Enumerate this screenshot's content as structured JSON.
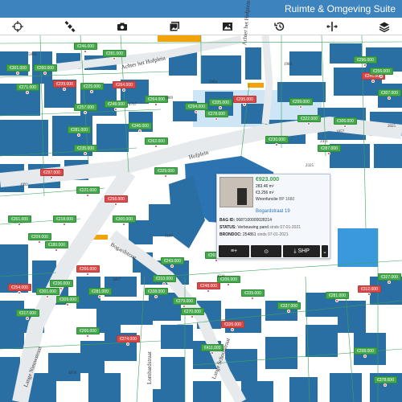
{
  "app": {
    "title": "Ruimte & Omgeving Suite"
  },
  "toolbar": {
    "items": [
      {
        "name": "crosshair-icon"
      },
      {
        "name": "satellite-icon"
      },
      {
        "name": "camera-icon"
      },
      {
        "name": "image-stack-icon"
      },
      {
        "name": "picture-icon"
      },
      {
        "name": "history-icon"
      },
      {
        "name": "split-icon"
      },
      {
        "name": "layers-icon"
      }
    ]
  },
  "map": {
    "colors": {
      "building": "#2a6fa3",
      "lot_blue": "#2c73b2",
      "light_blue": "#3a99db",
      "parcel_line": "#3aa35a",
      "road": "#e7eaed",
      "price": "#46a84d",
      "price_red": "#d84a48",
      "highlight": "#f0a30a"
    },
    "streets": [
      {
        "label": "Achter het Hofplein"
      },
      {
        "label": "Achter het Hofplein"
      },
      {
        "label": "Hofplein"
      },
      {
        "label": "Bogardstraat"
      },
      {
        "label": "Lange Nieuwstraat"
      },
      {
        "label": "Lombardstraat"
      },
      {
        "label": "Lange Schoolstraat"
      },
      {
        "label": "Bogardstraat 19"
      }
    ],
    "parcels": [
      "5064",
      "1984",
      "4767",
      "1869",
      "5094",
      "2325",
      "1992",
      "3867",
      "4511",
      "5107",
      "4878",
      "2025",
      "2411",
      "1857"
    ],
    "price_labels": [
      "€246.000",
      "€301.000",
      "€260.000",
      "€281.000",
      "€239.000",
      "€271.000",
      "€225.000",
      "€264.000",
      "€264.000",
      "€248.000",
      "€257.000",
      "€294.000",
      "€335.000",
      "€295.000",
      "€278.000",
      "€346.000",
      "€281.000",
      "€262.000",
      "€235.000",
      "€329.000",
      "€297.000",
      "€221.000",
      "€258.000",
      "€261.000",
      "€218.000",
      "€300.000",
      "€209.000",
      "€180.000",
      "€243.000",
      "€269.000",
      "€310.000",
      "€266.000",
      "€236.000",
      "€254.000",
      "€301.000",
      "€281.000",
      "€309.000",
      "€217.000",
      "€338.000",
      "€279.000",
      "€248.000",
      "€206.000",
      "€270.000",
      "€335.000",
      "€337.000",
      "€281.000",
      "€312.000",
      "€327.000",
      "€296.000",
      "€241.000",
      "€307.000",
      "€256.000",
      "€299.000",
      "€322.000",
      "€306.000",
      "€230.000",
      "€287.000",
      "€266.000",
      "€274.000",
      "€326.000",
      "€411.000",
      "€298.000",
      "€378.000"
    ]
  },
  "popup": {
    "price": "€923.000",
    "area": "283.46 m²",
    "price_per_m2": "€3.256 m²",
    "function": "Woonfunctie",
    "function_suffix": "BP 1660",
    "address": "Bogardstraat 19",
    "bag_id_label": "BAG ID:",
    "bag_id": "0687100000028214",
    "status_label": "STATUS:",
    "status": "Verbouwing pand",
    "status_since": "sinds 07-01-2021",
    "brondoc_label": "BRONDOC:",
    "brondoc": "254861",
    "brondoc_since": "sinds 07-01-2021",
    "actions": [
      {
        "label": "≡+",
        "name": "add-list-button"
      },
      {
        "label": "⊙",
        "name": "street-view-button"
      },
      {
        "label": "SHP",
        "name": "download-shp-button"
      },
      {
        "label": "⌄",
        "name": "more-button"
      }
    ]
  }
}
